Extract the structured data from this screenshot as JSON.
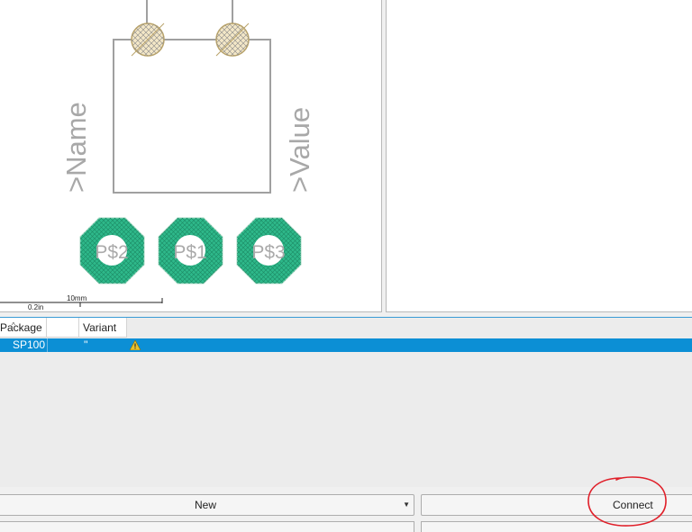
{
  "footprint": {
    "name_label": ">Name",
    "value_label": ">Value",
    "pads": [
      "P$2",
      "P$1",
      "P$3"
    ],
    "pad_color": "#2eb88a",
    "line_color": "#a0a0a0"
  },
  "scale": {
    "metric": "10mm",
    "imperial": "0.2in"
  },
  "table": {
    "columns": [
      "Package",
      "",
      "Variant"
    ],
    "rows": [
      {
        "package": "SP100",
        "variant": "''",
        "warning_icon": "warning-icon"
      }
    ],
    "selected_color": "#0c8fd5"
  },
  "buttons": {
    "new_label": "New",
    "connect_label": "Connect"
  },
  "annotation_color": "#e0202a"
}
